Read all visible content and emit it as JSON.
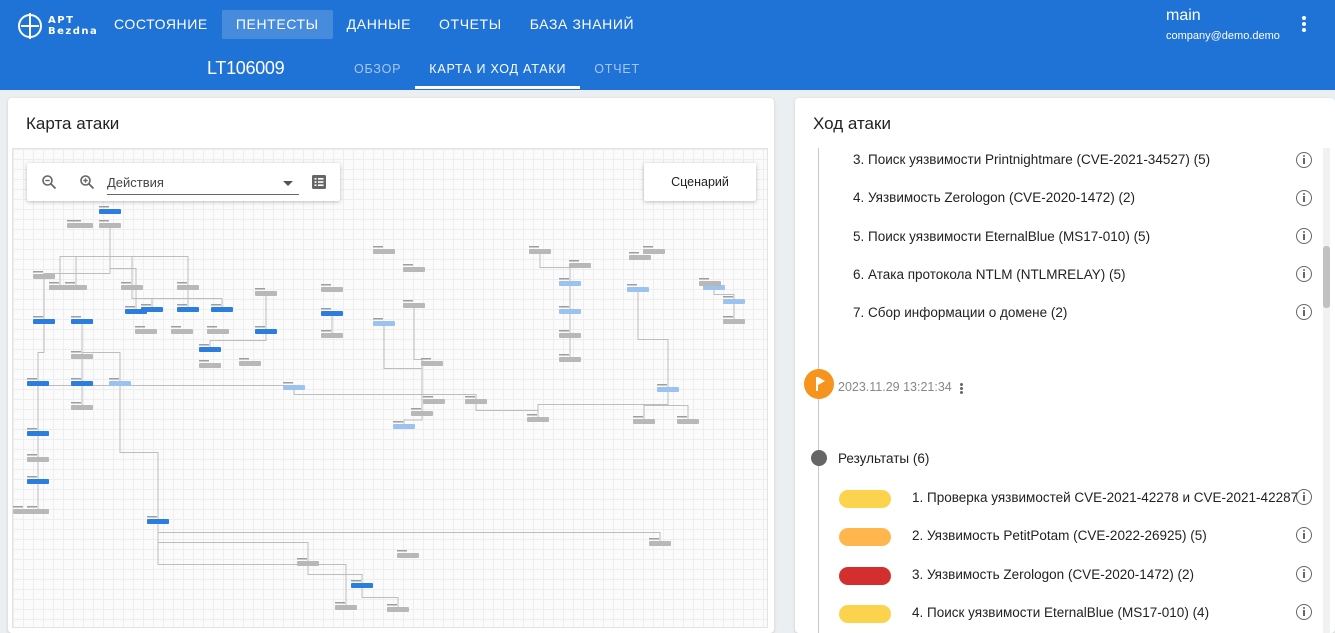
{
  "app": {
    "logo_line1": "APT",
    "logo_line2": "Bezdna"
  },
  "nav": [
    {
      "label": "СОСТОЯНИЕ"
    },
    {
      "label": "ПЕНТЕСТЫ",
      "active": true
    },
    {
      "label": "ДАННЫЕ"
    },
    {
      "label": "ОТЧЕТЫ"
    },
    {
      "label": "БАЗА ЗНАНИЙ"
    }
  ],
  "user": {
    "name": "main",
    "email": "company@demo.demo"
  },
  "project": {
    "id": "LT106009"
  },
  "subtabs": [
    {
      "label": "ОБЗОР"
    },
    {
      "label": "КАРТА И ХОД АТАКИ",
      "active": true
    },
    {
      "label": "ОТЧЕТ"
    }
  ],
  "map": {
    "title": "Карта атаки",
    "dropdown_value": "Действия",
    "scenario_button": "Сценарий",
    "icons": [
      "zoom-out-icon",
      "zoom-in-icon",
      "list-icon"
    ]
  },
  "progress": {
    "title": "Ход атаки",
    "items": [
      "3. Поиск уязвимости Printnightmare (CVE-2021-34527) (5)",
      "4. Уязвимость Zerologon (CVE-2020-1472) (2)",
      "5. Поиск уязвимости EternalBlue (MS17-010) (5)",
      "6. Атака протокола NTLM (NTLMRELAY) (5)",
      "7. Сбор информации о домене (2)"
    ],
    "timestamp": "2023.11.29 13:21:34",
    "results_label": "Результаты (6)",
    "results": [
      {
        "label": "1. Проверка уязвимостей CVE-2021-42278 и CVE-2021-42287",
        "color": "#fcd34d"
      },
      {
        "label": "2. Уязвимость PetitPotam (CVE-2022-26925) (5)",
        "color": "#ffb74d"
      },
      {
        "label": "3. Уязвимость Zerologon (CVE-2020-1472) (2)",
        "color": "#d32f2f"
      },
      {
        "label": "4. Поиск уязвимости EternalBlue (MS17-010) (4)",
        "color": "#fcd34d"
      }
    ]
  },
  "colors": {
    "header": "#1f72d6",
    "node_blue": "#2b7de0",
    "node_light": "#9cc2f0",
    "node_gray": "#b8b8b8",
    "flag": "#f7941d"
  }
}
